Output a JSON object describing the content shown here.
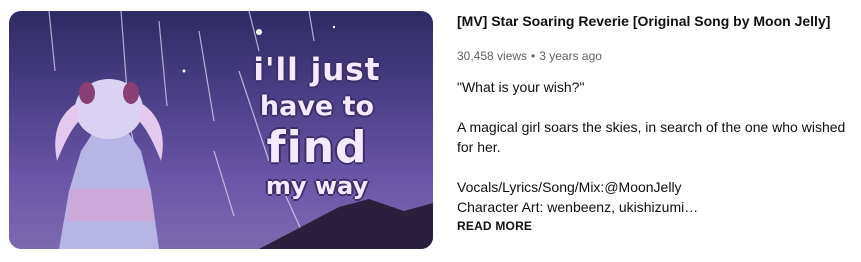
{
  "video": {
    "thumbnail": {
      "lines": [
        "i'll just",
        "have to",
        "find",
        "my way"
      ],
      "colors": {
        "sky_top": "#2e2a63",
        "sky_bottom": "#7c6ab0",
        "text": "#f4e9ff"
      }
    },
    "title": "[MV] Star Soaring Reverie [Original Song by Moon Jelly]",
    "views": "30,458 views",
    "separator": "•",
    "age": "3 years ago",
    "description": "\"What is your wish?\"\n\nA magical girl soars the skies, in search of the one who wished for her.\n\nVocals/Lyrics/Song/Mix:@MoonJelly\nCharacter Art: wenbeenz, ukishizumi…",
    "read_more_label": "READ MORE"
  }
}
